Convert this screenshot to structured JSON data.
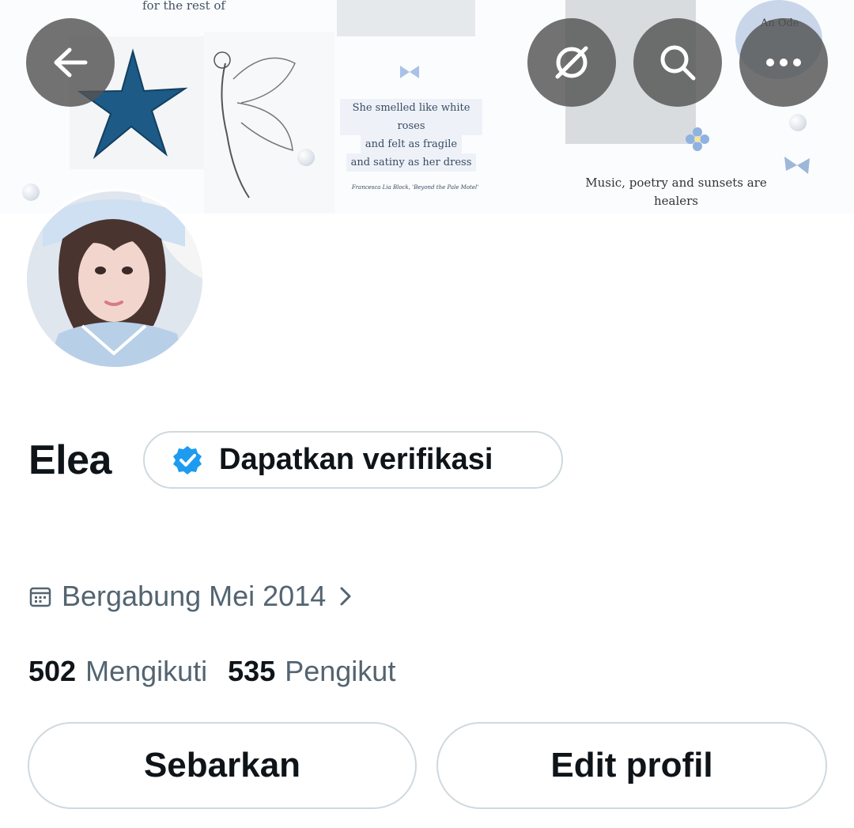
{
  "header": {
    "banner": {
      "top_left_text": "for the rest of",
      "quote_lines": [
        "She smelled like white roses",
        "and felt as fragile",
        "and satiny as her dress"
      ],
      "quote_credit": "Francesca Lia Block, 'Beyond the Pale Motel'",
      "right_caption": "Music, poetry and sunsets are healers",
      "right_top_text": "An Ode"
    },
    "back_icon": "arrow-left-icon",
    "grok_icon": "grok-icon",
    "search_icon": "search-icon",
    "more_icon": "more-horizontal-icon"
  },
  "profile": {
    "display_name": "Elea",
    "verify_label": "Dapatkan verifikasi",
    "badge_color": "#1d9bf0",
    "joined": "Bergabung Mei 2014",
    "following_count": "502",
    "following_label": "Mengikuti",
    "followers_count": "535",
    "followers_label": "Pengikut"
  },
  "actions": {
    "share_label": "Sebarkan",
    "edit_label": "Edit profil"
  },
  "colors": {
    "primary_text": "#0f1419",
    "secondary_text": "#536471",
    "border": "#cfd9de",
    "overlay_button": "#535353"
  }
}
